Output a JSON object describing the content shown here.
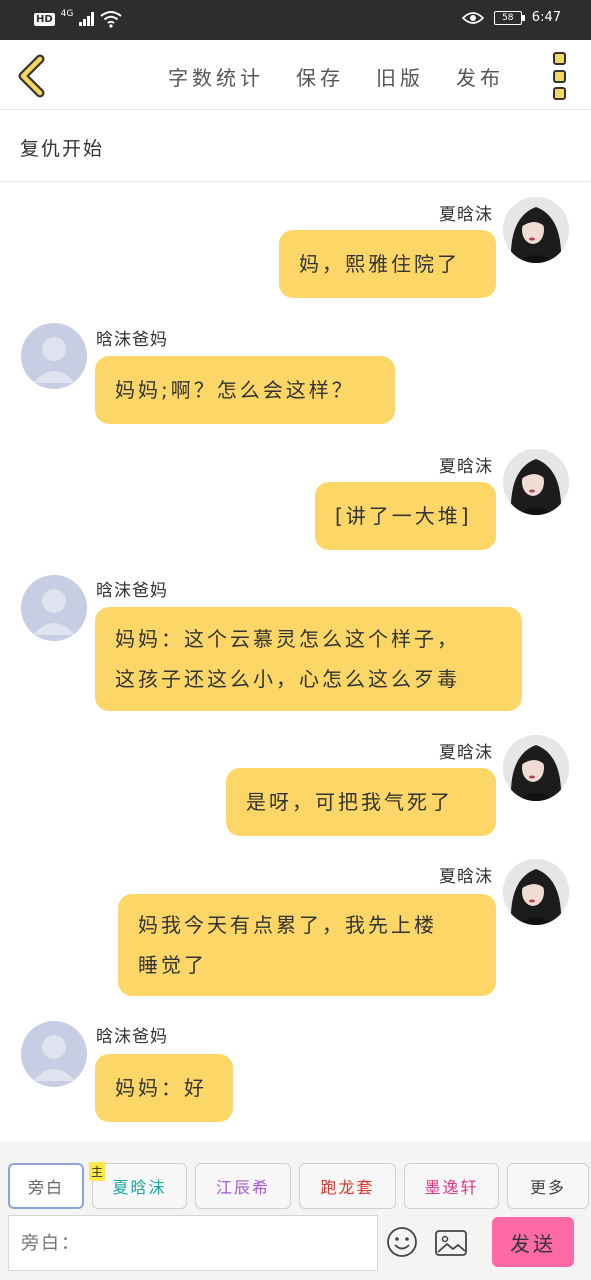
{
  "status_bar": {
    "hd": "HD",
    "network": "4G",
    "battery": "58",
    "time": "6:47"
  },
  "toolbar": {
    "actions": [
      "字数统计",
      "保存",
      "旧版",
      "发布"
    ],
    "accent_color": "#f5d65e"
  },
  "title": "复仇开始",
  "messages": [
    {
      "side": "right",
      "name": "夏晗沫",
      "text": "妈，熙雅住院了"
    },
    {
      "side": "left",
      "name": "晗沫爸妈",
      "text": "妈妈;啊？怎么会这样？"
    },
    {
      "side": "right",
      "name": "夏晗沫",
      "text": "[讲了一大堆]"
    },
    {
      "side": "left",
      "name": "晗沫爸妈",
      "lines": [
        "妈妈：这个云慕灵怎么这个样子，",
        "这孩子还这么小，心怎么这么歹毒"
      ]
    },
    {
      "side": "right",
      "name": "夏晗沫",
      "text": "是呀，可把我气死了"
    },
    {
      "side": "right",
      "name": "夏晗沫",
      "lines": [
        "妈我今天有点累了，我先上楼",
        "睡觉了"
      ]
    },
    {
      "side": "left",
      "name": "晗沫爸妈",
      "text": "妈妈：好"
    }
  ],
  "bubble_color": "#fcd768",
  "roles": [
    {
      "label": "旁白",
      "color": "#666666"
    },
    {
      "label": "夏晗沫",
      "color": "#1aa9a3",
      "tag": "主"
    },
    {
      "label": "江辰希",
      "color": "#a35bd6"
    },
    {
      "label": "跑龙套",
      "color": "#e0362c"
    },
    {
      "label": "墨逸轩",
      "color": "#e0368a"
    },
    {
      "label": "更多",
      "color": "#444444"
    }
  ],
  "input": {
    "placeholder": "旁白："
  },
  "send_label": "发送",
  "send_color": "#ff69a6"
}
